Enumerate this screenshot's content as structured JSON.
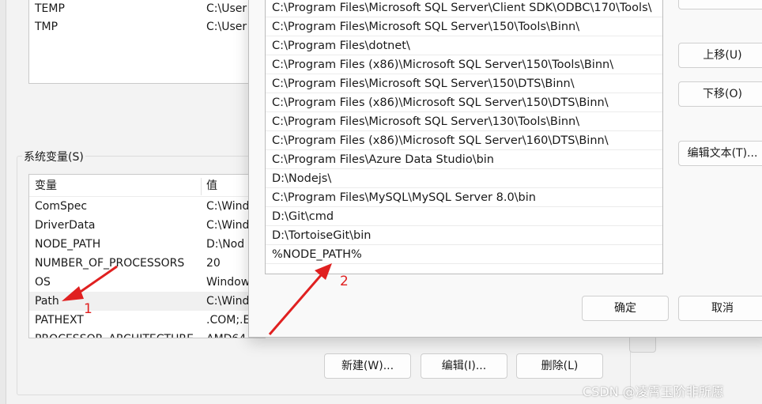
{
  "user_variables": [
    {
      "name": "TEMP",
      "value": "C:\\User"
    },
    {
      "name": "TMP",
      "value": "C:\\User"
    }
  ],
  "system_variables": {
    "group_label": "系统变量(S)",
    "headers": {
      "name": "变量",
      "value": "值"
    },
    "rows": [
      {
        "name": "ComSpec",
        "value": "C:\\Wind"
      },
      {
        "name": "DriverData",
        "value": "C:\\Wind"
      },
      {
        "name": "NODE_PATH",
        "value": "D:\\Nod"
      },
      {
        "name": "NUMBER_OF_PROCESSORS",
        "value": "20"
      },
      {
        "name": "OS",
        "value": "Window"
      },
      {
        "name": "Path",
        "value": "C:\\Wind"
      },
      {
        "name": "PATHEXT",
        "value": ".COM;.E"
      },
      {
        "name": "PROCESSOR_ARCHITECTURE",
        "value": "AMD64"
      }
    ],
    "selected": "Path",
    "buttons": {
      "new": "新建(W)...",
      "edit": "编辑(I)...",
      "delete": "删除(L)"
    }
  },
  "path_editor": {
    "entries": [
      "C:\\Program Files\\Microsoft SQL Server\\Client SDK\\ODBC\\170\\Tools\\",
      "C:\\Program Files\\Microsoft SQL Server\\150\\Tools\\Binn\\",
      "C:\\Program Files\\dotnet\\",
      "C:\\Program Files (x86)\\Microsoft SQL Server\\150\\Tools\\Binn\\",
      "C:\\Program Files\\Microsoft SQL Server\\150\\DTS\\Binn\\",
      "C:\\Program Files (x86)\\Microsoft SQL Server\\150\\DTS\\Binn\\",
      "C:\\Program Files\\Microsoft SQL Server\\130\\Tools\\Binn\\",
      "C:\\Program Files (x86)\\Microsoft SQL Server\\160\\DTS\\Binn\\",
      "C:\\Program Files\\Azure Data Studio\\bin",
      "D:\\Nodejs\\",
      "C:\\Program Files\\MySQL\\MySQL Server 8.0\\bin",
      "D:\\Git\\cmd",
      "D:\\TortoiseGit\\bin",
      "%NODE_PATH%"
    ],
    "buttons": {
      "move_up": "上移(U)",
      "move_down": "下移(O)",
      "edit_text": "编辑文本(T)...",
      "ok": "确定",
      "cancel": "取消"
    }
  },
  "annotations": {
    "marker_1": "1",
    "marker_2": "2",
    "color": "#e02020"
  },
  "watermark": "CSDN @凌霄玉阶非所愿"
}
